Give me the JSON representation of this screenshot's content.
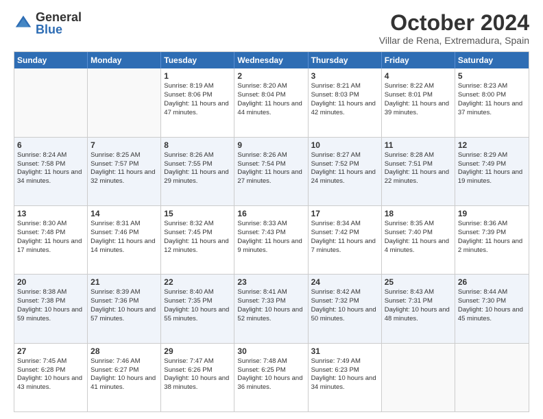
{
  "logo": {
    "general": "General",
    "blue": "Blue"
  },
  "title": "October 2024",
  "subtitle": "Villar de Rena, Extremadura, Spain",
  "days": [
    "Sunday",
    "Monday",
    "Tuesday",
    "Wednesday",
    "Thursday",
    "Friday",
    "Saturday"
  ],
  "weeks": [
    [
      {
        "day": "",
        "empty": true
      },
      {
        "day": "",
        "empty": true
      },
      {
        "day": "1",
        "sunrise": "Sunrise: 8:19 AM",
        "sunset": "Sunset: 8:06 PM",
        "daylight": "Daylight: 11 hours and 47 minutes."
      },
      {
        "day": "2",
        "sunrise": "Sunrise: 8:20 AM",
        "sunset": "Sunset: 8:04 PM",
        "daylight": "Daylight: 11 hours and 44 minutes."
      },
      {
        "day": "3",
        "sunrise": "Sunrise: 8:21 AM",
        "sunset": "Sunset: 8:03 PM",
        "daylight": "Daylight: 11 hours and 42 minutes."
      },
      {
        "day": "4",
        "sunrise": "Sunrise: 8:22 AM",
        "sunset": "Sunset: 8:01 PM",
        "daylight": "Daylight: 11 hours and 39 minutes."
      },
      {
        "day": "5",
        "sunrise": "Sunrise: 8:23 AM",
        "sunset": "Sunset: 8:00 PM",
        "daylight": "Daylight: 11 hours and 37 minutes."
      }
    ],
    [
      {
        "day": "6",
        "sunrise": "Sunrise: 8:24 AM",
        "sunset": "Sunset: 7:58 PM",
        "daylight": "Daylight: 11 hours and 34 minutes."
      },
      {
        "day": "7",
        "sunrise": "Sunrise: 8:25 AM",
        "sunset": "Sunset: 7:57 PM",
        "daylight": "Daylight: 11 hours and 32 minutes."
      },
      {
        "day": "8",
        "sunrise": "Sunrise: 8:26 AM",
        "sunset": "Sunset: 7:55 PM",
        "daylight": "Daylight: 11 hours and 29 minutes."
      },
      {
        "day": "9",
        "sunrise": "Sunrise: 8:26 AM",
        "sunset": "Sunset: 7:54 PM",
        "daylight": "Daylight: 11 hours and 27 minutes."
      },
      {
        "day": "10",
        "sunrise": "Sunrise: 8:27 AM",
        "sunset": "Sunset: 7:52 PM",
        "daylight": "Daylight: 11 hours and 24 minutes."
      },
      {
        "day": "11",
        "sunrise": "Sunrise: 8:28 AM",
        "sunset": "Sunset: 7:51 PM",
        "daylight": "Daylight: 11 hours and 22 minutes."
      },
      {
        "day": "12",
        "sunrise": "Sunrise: 8:29 AM",
        "sunset": "Sunset: 7:49 PM",
        "daylight": "Daylight: 11 hours and 19 minutes."
      }
    ],
    [
      {
        "day": "13",
        "sunrise": "Sunrise: 8:30 AM",
        "sunset": "Sunset: 7:48 PM",
        "daylight": "Daylight: 11 hours and 17 minutes."
      },
      {
        "day": "14",
        "sunrise": "Sunrise: 8:31 AM",
        "sunset": "Sunset: 7:46 PM",
        "daylight": "Daylight: 11 hours and 14 minutes."
      },
      {
        "day": "15",
        "sunrise": "Sunrise: 8:32 AM",
        "sunset": "Sunset: 7:45 PM",
        "daylight": "Daylight: 11 hours and 12 minutes."
      },
      {
        "day": "16",
        "sunrise": "Sunrise: 8:33 AM",
        "sunset": "Sunset: 7:43 PM",
        "daylight": "Daylight: 11 hours and 9 minutes."
      },
      {
        "day": "17",
        "sunrise": "Sunrise: 8:34 AM",
        "sunset": "Sunset: 7:42 PM",
        "daylight": "Daylight: 11 hours and 7 minutes."
      },
      {
        "day": "18",
        "sunrise": "Sunrise: 8:35 AM",
        "sunset": "Sunset: 7:40 PM",
        "daylight": "Daylight: 11 hours and 4 minutes."
      },
      {
        "day": "19",
        "sunrise": "Sunrise: 8:36 AM",
        "sunset": "Sunset: 7:39 PM",
        "daylight": "Daylight: 11 hours and 2 minutes."
      }
    ],
    [
      {
        "day": "20",
        "sunrise": "Sunrise: 8:38 AM",
        "sunset": "Sunset: 7:38 PM",
        "daylight": "Daylight: 10 hours and 59 minutes."
      },
      {
        "day": "21",
        "sunrise": "Sunrise: 8:39 AM",
        "sunset": "Sunset: 7:36 PM",
        "daylight": "Daylight: 10 hours and 57 minutes."
      },
      {
        "day": "22",
        "sunrise": "Sunrise: 8:40 AM",
        "sunset": "Sunset: 7:35 PM",
        "daylight": "Daylight: 10 hours and 55 minutes."
      },
      {
        "day": "23",
        "sunrise": "Sunrise: 8:41 AM",
        "sunset": "Sunset: 7:33 PM",
        "daylight": "Daylight: 10 hours and 52 minutes."
      },
      {
        "day": "24",
        "sunrise": "Sunrise: 8:42 AM",
        "sunset": "Sunset: 7:32 PM",
        "daylight": "Daylight: 10 hours and 50 minutes."
      },
      {
        "day": "25",
        "sunrise": "Sunrise: 8:43 AM",
        "sunset": "Sunset: 7:31 PM",
        "daylight": "Daylight: 10 hours and 48 minutes."
      },
      {
        "day": "26",
        "sunrise": "Sunrise: 8:44 AM",
        "sunset": "Sunset: 7:30 PM",
        "daylight": "Daylight: 10 hours and 45 minutes."
      }
    ],
    [
      {
        "day": "27",
        "sunrise": "Sunrise: 7:45 AM",
        "sunset": "Sunset: 6:28 PM",
        "daylight": "Daylight: 10 hours and 43 minutes."
      },
      {
        "day": "28",
        "sunrise": "Sunrise: 7:46 AM",
        "sunset": "Sunset: 6:27 PM",
        "daylight": "Daylight: 10 hours and 41 minutes."
      },
      {
        "day": "29",
        "sunrise": "Sunrise: 7:47 AM",
        "sunset": "Sunset: 6:26 PM",
        "daylight": "Daylight: 10 hours and 38 minutes."
      },
      {
        "day": "30",
        "sunrise": "Sunrise: 7:48 AM",
        "sunset": "Sunset: 6:25 PM",
        "daylight": "Daylight: 10 hours and 36 minutes."
      },
      {
        "day": "31",
        "sunrise": "Sunrise: 7:49 AM",
        "sunset": "Sunset: 6:23 PM",
        "daylight": "Daylight: 10 hours and 34 minutes."
      },
      {
        "day": "",
        "empty": true
      },
      {
        "day": "",
        "empty": true
      }
    ]
  ]
}
